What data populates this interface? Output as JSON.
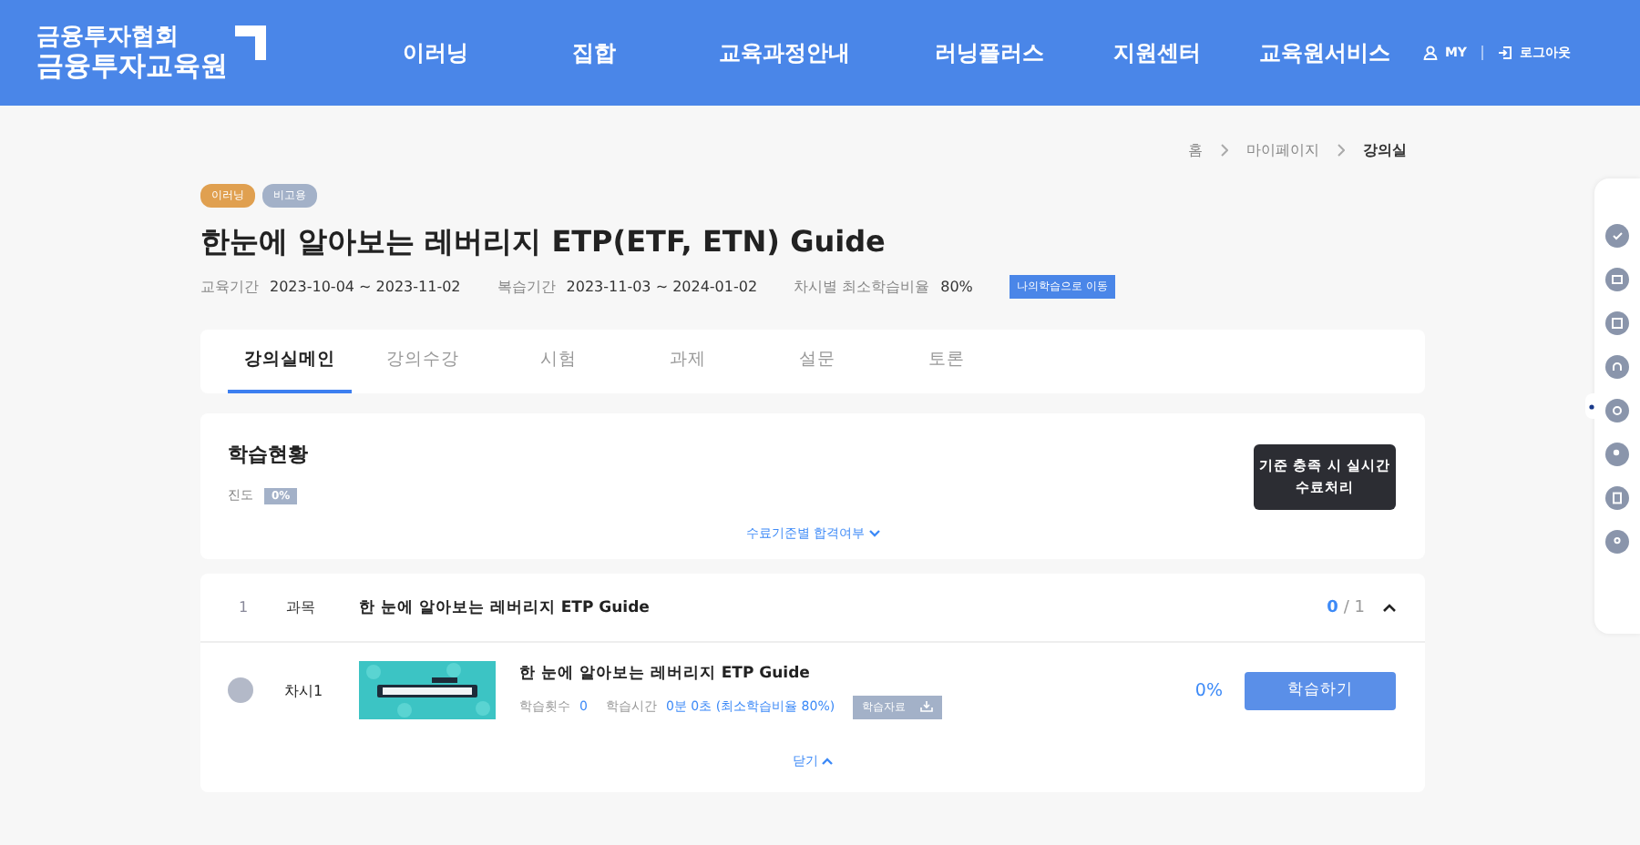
{
  "header": {
    "logo": [
      "금융투자협회",
      "금융투자교육원"
    ],
    "nav": [
      "이러닝",
      "집합",
      "교육과정안내",
      "러닝플러스",
      "지원센터",
      "교육원서비스"
    ],
    "user_links": [
      {
        "kind": "user",
        "label": "MY"
      },
      {
        "kind": "logout",
        "label": "로그아웃"
      }
    ]
  },
  "breadcrumb": [
    "홈",
    "마이페이지",
    "강의실"
  ],
  "tags": [
    {
      "label": "이러닝",
      "color": "#e0a050"
    },
    {
      "label": "비고용",
      "color": "#a3b1c8"
    }
  ],
  "title": "한눈에 알아보는 레버리지 ETP(ETF, ETN) Guide",
  "info": [
    {
      "label": "교육기간",
      "value": "2023-10-04 ~ 2023-11-02"
    },
    {
      "label": "복습기간",
      "value": "2023-11-03 ~ 2024-01-02"
    },
    {
      "label": "차시별 최소학습비율",
      "value": "80%"
    }
  ],
  "move_button": "나의학습으로 이동",
  "tabs": [
    {
      "label": "강의실메인",
      "selected": true
    },
    {
      "label": "강의수강",
      "selected": false
    },
    {
      "label": "시험",
      "selected": false
    },
    {
      "label": "과제",
      "selected": false
    },
    {
      "label": "설문",
      "selected": false
    },
    {
      "label": "토론",
      "selected": false
    }
  ],
  "status": {
    "title": "학습현황",
    "progress_label": "진도",
    "progress_value": "0%",
    "complete_button": "기준 충족 시 실시간\n수료처리",
    "criteria_link": "수료기준별 합격여부"
  },
  "course": {
    "number": "1",
    "type": "과목",
    "title": "한 눈에 알아보는 레버리지 ETP Guide",
    "done": "0",
    "total": "/ 1",
    "expanded": true,
    "lessons": [
      {
        "completed": false,
        "label": "차시1",
        "title": "한 눈에 알아보는 레버리지 ETP Guide",
        "count_label": "학습횟수",
        "count": "0",
        "time_label": "학습시간",
        "time": "0분 0초 (최소학습비율 80%)",
        "material": "학습자료",
        "percent": "0%",
        "button": "학습하기"
      }
    ],
    "close": "닫기"
  }
}
